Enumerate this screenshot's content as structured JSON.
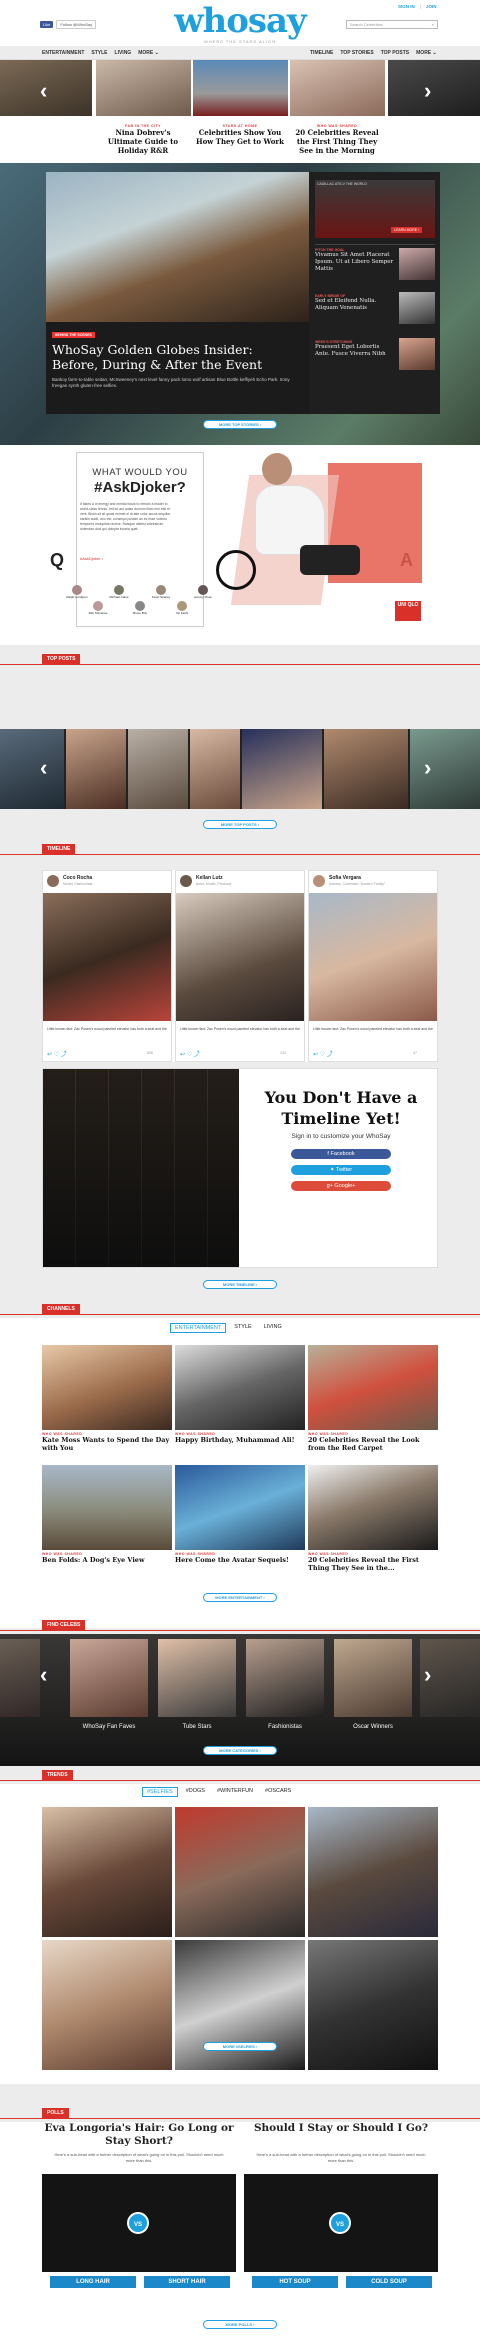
{
  "header": {
    "logo": "whosay",
    "tagline": "WHERE THE STARS ALIGN",
    "signin": "SIGN IN",
    "join": "JOIN",
    "fb_like": "Like",
    "tw_follow": "Follow @WhoSay",
    "search_placeholder": "Search Celebrities"
  },
  "nav_left": [
    "ENTERTAINMENT",
    "STYLE",
    "LIVING",
    "MORE ⌄"
  ],
  "nav_right": [
    "TIMELINE",
    "TOP STORIES",
    "TOP POSTS",
    "MORE ⌄"
  ],
  "strip": [
    {
      "cat": "FAB IN THE CITY",
      "title": "Nina Dobrev's Ultimate Guide to Holiday R&R"
    },
    {
      "cat": "STARS AT HOME",
      "title": "Celebrities Show You How They Get to Work"
    },
    {
      "cat": "WHO WAS SHARED",
      "title": "20 Celebrities Reveal the First Thing They See in the Morning"
    }
  ],
  "feature": {
    "label": "BEHIND THE SCENES",
    "title": "WhoSay Golden Globes Insider: Before, During & After the Event",
    "deck": "Bankoy farm-to-table seitan, McSweeney's next level fanny pack lomo wolf artisan Blue Bottle keffiyeh Echo Park. Irony freegan synth gluten-free selfies.",
    "promo_label": "CADILLAC ATS-V THE WORLD",
    "promo_btn": "LEARN MORE ›",
    "side": [
      {
        "cat": "PITCH THE GOAL",
        "title": "Vivamus Sit Amet Placerat Ipsum. Ut at Libero Semper Mattis"
      },
      {
        "cat": "EARLY BIRDIE OF",
        "title": "Sed et Eleifend Nulla. Aliquam Venenatis"
      },
      {
        "cat": "WEEK'S STRETCHING",
        "title": "Praesent Eget Lobortis Ante. Fusce Viverra Nibh"
      }
    ],
    "more": "MORE TOP STORIES ›"
  },
  "ad": {
    "title_small": "WHAT WOULD YOU",
    "title_big": "#AskDjoker?",
    "body": "It takes a of energy and mental focus to remain a leader in world-class tennis. Irrit iut aut autas doorum illum mni esti re vent. Bistin sit sit quasi enimet el di-tate volor accus sequibu santiin audit, ano est, consequi possim as es esse volecto tempores molupitas recese. Raisque distest voleestrum dolendan-duci qui dolupta incaria quat.",
    "hashtag": "#AskDjoker ›",
    "people": [
      "Ralph Lundgren",
      "Michael Caine",
      "Kevin Spacey",
      "Jeremy Piven",
      "Dirk Shmanse",
      "Bruce Bris",
      "Vic Fashi"
    ],
    "letter_q": "Q",
    "letter_a": "A",
    "brand": "UNI QLO"
  },
  "sections": {
    "top_posts": "TOP POSTS",
    "timeline": "TIMELINE",
    "channels": "CHANNELS",
    "find_celebs": "FIND CELEBS",
    "trends": "TRENDS",
    "polls": "POLLS"
  },
  "top_posts_more": "MORE TOP POSTS ›",
  "timeline": {
    "cards": [
      {
        "name": "Coco Rocha",
        "sub": "Model, Fashionista",
        "text": "Little known fact: Zac Posen's wood paneled elevator has both a seat and the",
        "count": "508"
      },
      {
        "name": "Kellan Lutz",
        "sub": "Actor, Model, Producer",
        "text": "Little known fact: Zac Posen's wood paneled elevator has both a seat and the",
        "count": "134"
      },
      {
        "name": "Sofia Vergara",
        "sub": "Actress, Comedian \"Modern Family\"",
        "text": "Little known fact: Zac Posen's wood paneled elevator has both a seat and the",
        "count": "47"
      }
    ],
    "cta_title": "You Don't Have a Timeline Yet!",
    "cta_sub": "Sign in to customize your WhoSay",
    "facebook": "Facebook",
    "twitter": "Twitter",
    "google": "Google+",
    "more": "MORE TIMELINE ›"
  },
  "channels": {
    "tabs": [
      "ENTERTAINMENT",
      "STYLE",
      "LIVING"
    ],
    "items": [
      {
        "cat": "WHO WAS SHARED",
        "title": "Kate Moss Wants to Spend the Day with You"
      },
      {
        "cat": "WHO WAS SHARED",
        "title": "Happy Birthday, Muhammad Ali!"
      },
      {
        "cat": "WHO WAS SHARED",
        "title": "20 Celebrities Reveal the Look from the Red Carpet"
      },
      {
        "cat": "WHO WAS SHARED",
        "title": "Ben Folds: A Dog's Eye View"
      },
      {
        "cat": "WHO WAS SHARED",
        "title": "Here Come the Avatar Sequels!"
      },
      {
        "cat": "WHO WAS SHARED",
        "title": "20 Celebrities Reveal the First Thing They See in the..."
      }
    ],
    "more": "MORE ENTERTAINMENT ›"
  },
  "find_celebs": {
    "groups": [
      "WhoSay Fan Faves",
      "Tube Stars",
      "Fashionistas",
      "Oscar Winners"
    ],
    "more": "MORE CATEGORIES ›"
  },
  "trends": {
    "tabs": [
      "#SELFIES",
      "#DOGS",
      "#WINTERFUN",
      "#OSCARS"
    ],
    "more": "MORE #SELFIES ›"
  },
  "polls": {
    "items": [
      {
        "title": "Eva Longoria's Hair: Go Long or Stay Short?",
        "desc": "Here's a sub-head with a further description of what's going on in this poll. Shouldn't need much more than this.",
        "a": "LONG HAIR",
        "b": "SHORT HAIR"
      },
      {
        "title": "Should I Stay or Should I Go?",
        "desc": "Here's a sub-head with a further description of what's going on in this poll. Shouldn't need much more than this.",
        "a": "HOT SOUP",
        "b": "COLD SOUP"
      }
    ],
    "vs": "VS",
    "more": "MORE POLLS ›"
  },
  "colors": {
    "accent": "#1ea0de",
    "red": "#d9302a",
    "facebook": "#3b5998",
    "twitter": "#1ea0de",
    "google": "#dd4b39"
  }
}
